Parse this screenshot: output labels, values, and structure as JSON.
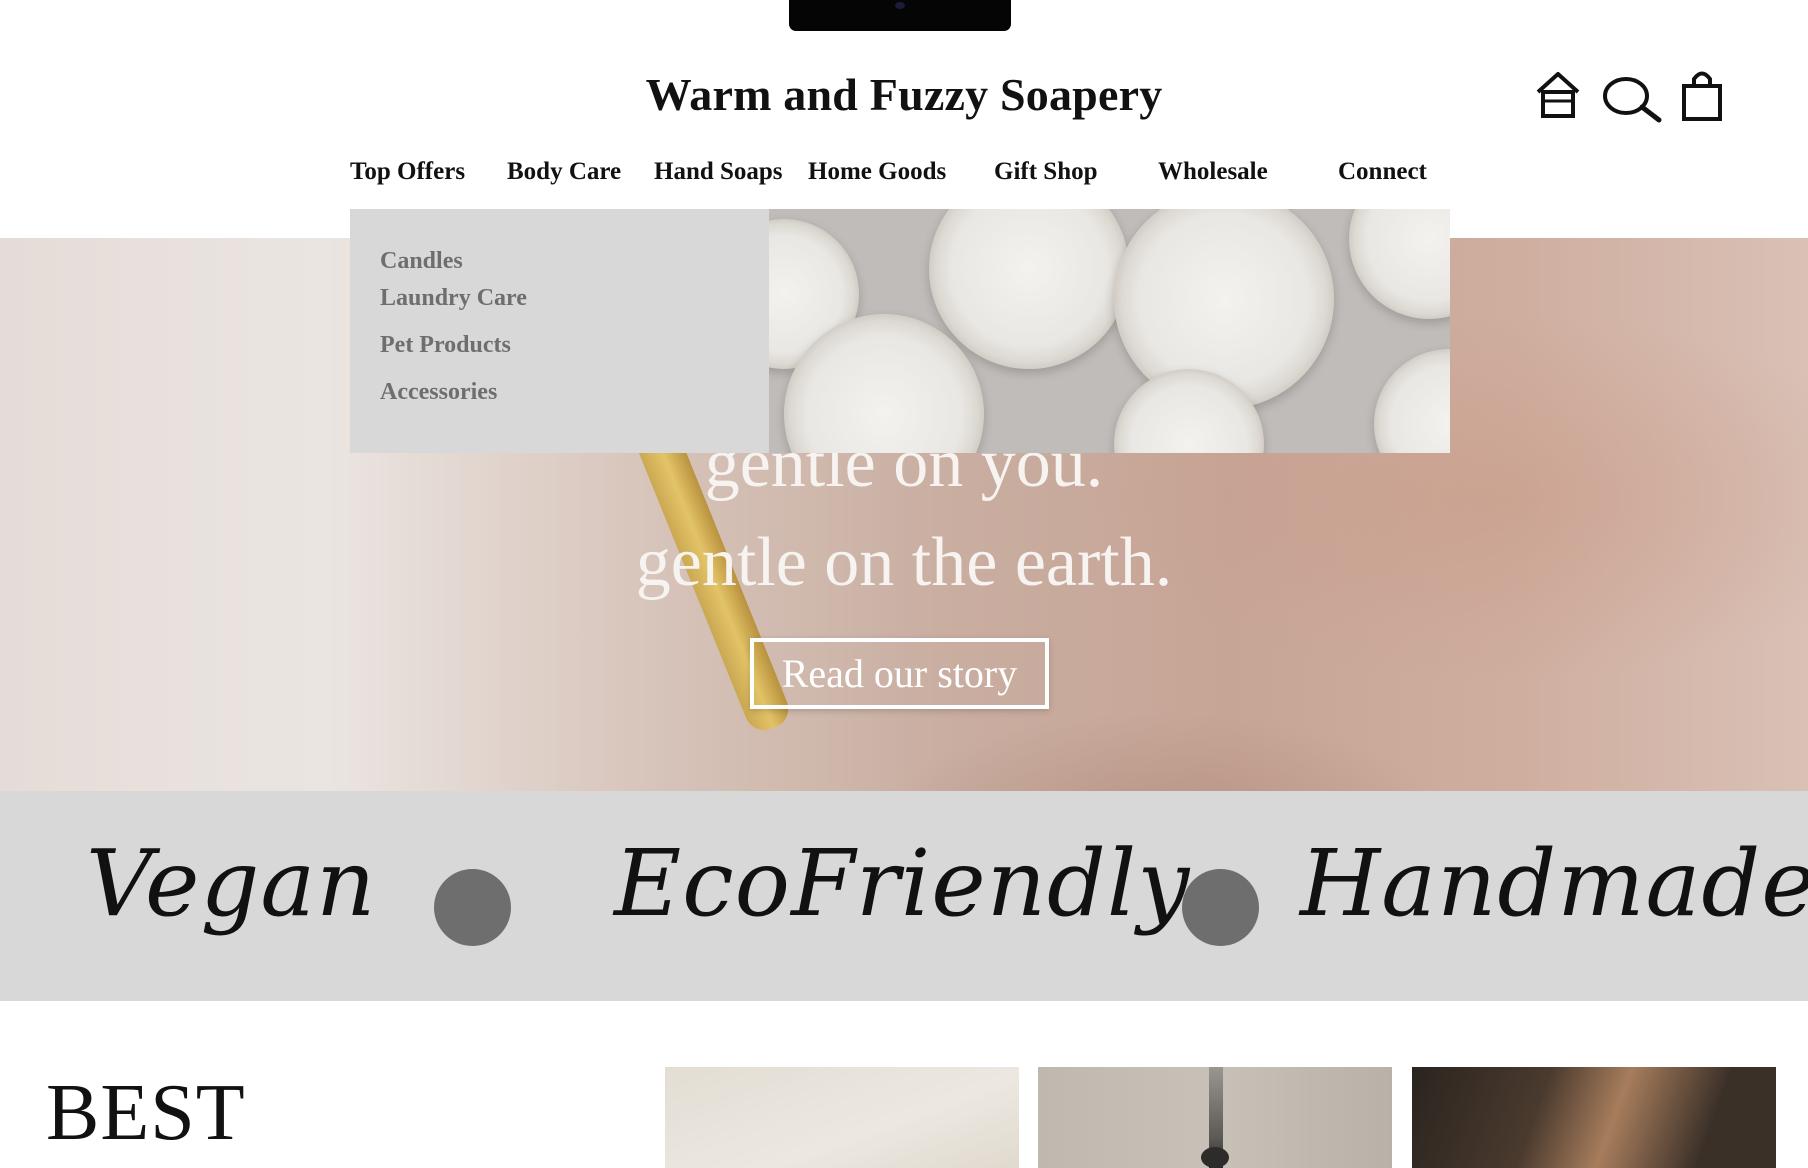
{
  "header": {
    "brand": "Warm and Fuzzy Soapery",
    "icons": [
      "home-icon",
      "search-icon",
      "bag-icon"
    ]
  },
  "nav": {
    "items": [
      "Top Offers",
      "Body Care",
      "Hand Soaps",
      "Home Goods",
      "Gift Shop",
      "Wholesale",
      "Connect"
    ]
  },
  "dropdown": {
    "items": [
      "Candles",
      "Laundry Care",
      "Pet Products",
      "Accessories"
    ]
  },
  "hero": {
    "line1": "gentle on you.",
    "line2": "gentle on the earth.",
    "button": "Read our story"
  },
  "values": {
    "items": [
      "Vegan",
      "EcoFriendly",
      "Handmade"
    ]
  },
  "section": {
    "heading": "BEST"
  },
  "colors": {
    "dropdown_bg": "#d8d8d8",
    "dropdown_text": "#6e6e6e",
    "band_bg": "#d8d8d8",
    "dot": "#6e6e6e"
  }
}
